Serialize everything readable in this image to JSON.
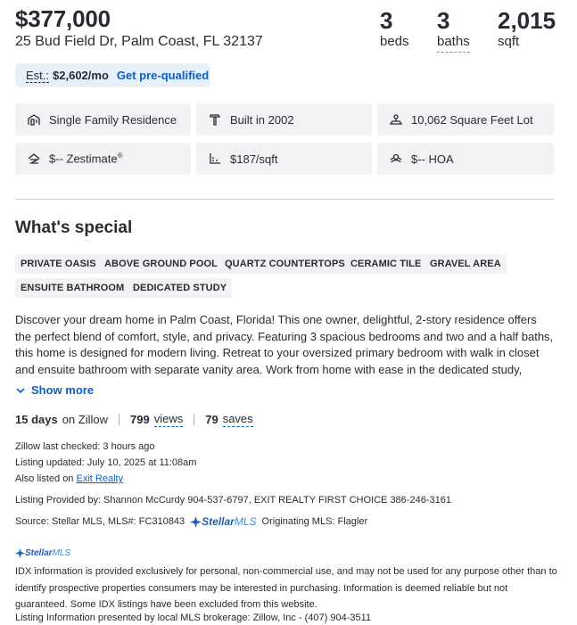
{
  "header": {
    "price": "$377,000",
    "address": "25 Bud Field Dr, Palm Coast, FL 32137",
    "beds_value": "3",
    "beds_label": "beds",
    "baths_value": "3",
    "baths_label": "baths",
    "sqft_value": "2,015",
    "sqft_label": "sqft"
  },
  "estimate": {
    "est_label": "Est.:",
    "amount": "$2,602/mo",
    "prequalify_label": "Get pre-qualified"
  },
  "facts": [
    {
      "icon": "house-icon",
      "text": "Single Family Residence"
    },
    {
      "icon": "hammer-icon",
      "text": "Built in 2002"
    },
    {
      "icon": "lot-icon",
      "text": "10,062 Square Feet Lot"
    },
    {
      "icon": "zestimate-icon",
      "text": "$-- Zestimate",
      "sup": "®"
    },
    {
      "icon": "price-per-sqft-icon",
      "text": "$187/sqft"
    },
    {
      "icon": "hoa-icon",
      "text": "$-- HOA"
    }
  ],
  "special": {
    "title": "What's special",
    "tags": [
      "PRIVATE OASIS",
      "ABOVE GROUND POOL",
      "QUARTZ COUNTERTOPS",
      "CERAMIC TILE",
      "GRAVEL AREA",
      "ENSUITE BATHROOM",
      "DEDICATED STUDY"
    ],
    "description": "Discover your dream home in Palm Coast, Florida! This one owner, delightful, 2-story residence offers the perfect blend of comfort, style, and privacy. Featuring 3 spacious bedrooms and two and a half baths, this home is designed for modern living. Retreat to your oversized primary bedroom with walk in closet and ensuite bathroom with separate vanity area.  Work from home with ease in the dedicated study, providing a",
    "show_more_label": "Show more"
  },
  "activity": {
    "days_value": "15 days",
    "days_label": "on Zillow",
    "views_value": "799",
    "views_label": "views",
    "saves_value": "79",
    "saves_label": "saves"
  },
  "listing_meta": {
    "last_checked": "Zillow last checked: 3 hours ago",
    "updated": "Listing updated: July 10, 2025 at 11:08am",
    "also_listed_prefix": "Also listed on",
    "also_listed_link": "Exit Realty",
    "provided_by": "Listing Provided by: Shannon McCurdy 904-537-6797, EXIT REALTY FIRST CHOICE 386-246-3161",
    "source": "Source: Stellar MLS,  MLS#: FC310843",
    "logo_bold": "Stellar",
    "logo_light": "MLS",
    "originating": "Originating MLS: Flagler",
    "disclaimer": "IDX information is provided exclusively for personal, non-commercial use, and may not be used for any purpose other than to identify prospective properties consumers may be interested in purchasing. Information is deemed reliable but not guaranteed. Some IDX listings have been excluded from this website.",
    "brokerage": "Listing Information presented by local MLS brokerage: Zillow, Inc - (407) 904-3511"
  },
  "colors": {
    "link_blue": "#0d5fc2",
    "pill_bg": "#e5f0fa",
    "fact_bg": "#f2f2f4",
    "text": "#2a2a33"
  }
}
